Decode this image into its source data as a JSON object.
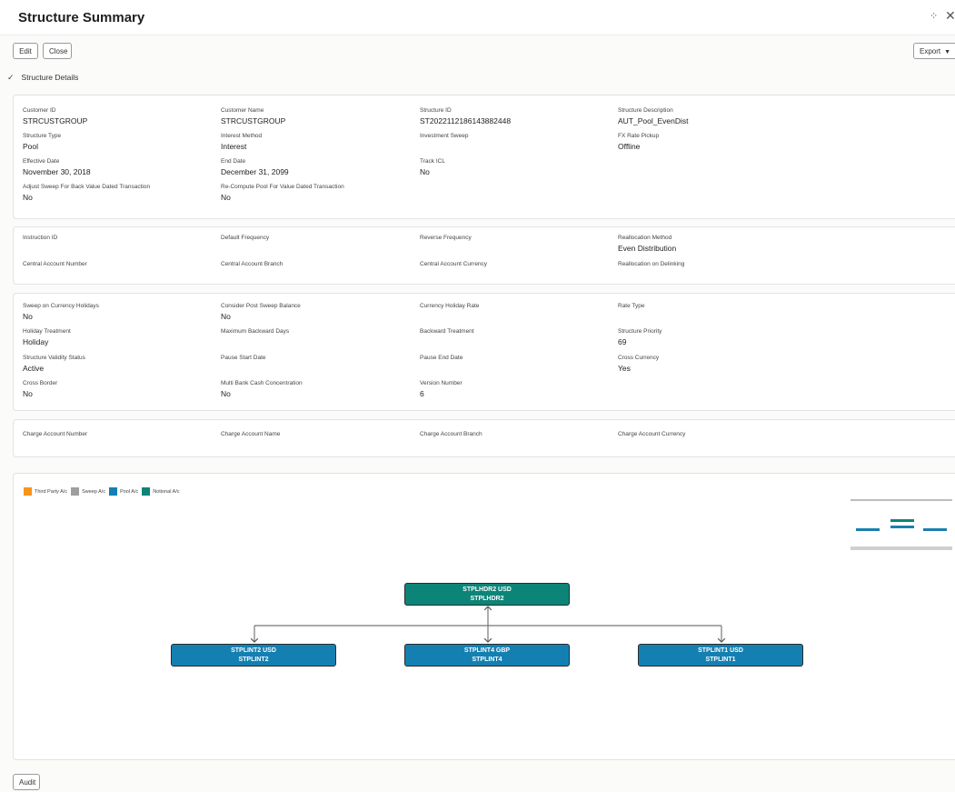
{
  "window": {
    "title": "Structure Summary"
  },
  "toolbar": {
    "edit_label": "Edit",
    "close_label": "Close",
    "export_label": "Export"
  },
  "section": {
    "title": "Structure Details"
  },
  "card1": [
    {
      "label": "Customer ID",
      "value": "STRCUSTGROUP"
    },
    {
      "label": "Customer Name",
      "value": "STRCUSTGROUP"
    },
    {
      "label": "Structure ID",
      "value": "ST2022112186143882448"
    },
    {
      "label": "Structure Description",
      "value": "AUT_Pool_EvenDist"
    },
    {
      "label": "Structure Type",
      "value": "Pool"
    },
    {
      "label": "Interest Method",
      "value": "Interest"
    },
    {
      "label": "Investment Sweep",
      "value": ""
    },
    {
      "label": "FX Rate Pickup",
      "value": "Offline"
    },
    {
      "label": "Effective Date",
      "value": "November 30, 2018"
    },
    {
      "label": "End Date",
      "value": "December 31, 2099"
    },
    {
      "label": "Track ICL",
      "value": "No"
    },
    {
      "label": "Adjust Sweep For Back Value Dated Transaction",
      "value": "No"
    },
    {
      "label": "Re-Compute Pool For Value Dated Transaction",
      "value": "No"
    }
  ],
  "card2": [
    {
      "label": "Instruction ID",
      "value": ""
    },
    {
      "label": "Default Frequency",
      "value": ""
    },
    {
      "label": "Reverse Frequency",
      "value": ""
    },
    {
      "label": "Reallocation Method",
      "value": "Even Distribution"
    },
    {
      "label": "Central Account Number",
      "value": ""
    },
    {
      "label": "Central Account Branch",
      "value": ""
    },
    {
      "label": "Central Account Currency",
      "value": ""
    },
    {
      "label": "Reallocation on Delinking",
      "value": ""
    }
  ],
  "card3": [
    {
      "label": "Sweep on Currency Holidays",
      "value": "No"
    },
    {
      "label": "Consider Post Sweep Balance",
      "value": "No"
    },
    {
      "label": "Currency Holiday Rate",
      "value": ""
    },
    {
      "label": "Rate Type",
      "value": ""
    },
    {
      "label": "Holiday Treatment",
      "value": "Holiday"
    },
    {
      "label": "Maximum Backward Days",
      "value": ""
    },
    {
      "label": "Backward Treatment",
      "value": ""
    },
    {
      "label": "Structure Priority",
      "value": "69"
    },
    {
      "label": "Structure Validity Status",
      "value": "Active"
    },
    {
      "label": "Pause Start Date",
      "value": ""
    },
    {
      "label": "Pause End Date",
      "value": ""
    },
    {
      "label": "Cross Currency",
      "value": "Yes"
    },
    {
      "label": "Cross Border",
      "value": "No"
    },
    {
      "label": "Multi Bank Cash Concentration",
      "value": "No"
    },
    {
      "label": "Version Number",
      "value": "6"
    }
  ],
  "card4": [
    {
      "label": "Charge Account Number",
      "value": ""
    },
    {
      "label": "Charge Account Name",
      "value": ""
    },
    {
      "label": "Charge Account Branch",
      "value": ""
    },
    {
      "label": "Charge Account Currency",
      "value": ""
    }
  ],
  "legend": [
    {
      "label": "Third Party A/c",
      "color": "#f7941d"
    },
    {
      "label": "Sweep A/c",
      "color": "#9e9e9e"
    },
    {
      "label": "Pool A/c",
      "color": "#1480b2"
    },
    {
      "label": "Notional A/c",
      "color": "#0d8478"
    }
  ],
  "tree": {
    "root": {
      "line1": "STPLHDR2 USD",
      "line2": "STPLHDR2",
      "kind": "notional"
    },
    "children": [
      {
        "line1": "STPLINT2 USD",
        "line2": "STPLINT2",
        "kind": "pool"
      },
      {
        "line1": "STPLINT4 GBP",
        "line2": "STPLINT4",
        "kind": "pool"
      },
      {
        "line1": "STPLINT1 USD",
        "line2": "STPLINT1",
        "kind": "pool"
      }
    ]
  },
  "footer": {
    "audit_label": "Audit"
  }
}
